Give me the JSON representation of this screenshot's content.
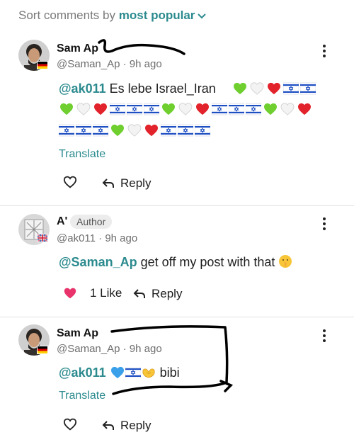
{
  "sort": {
    "label": "Sort comments by",
    "value": "most popular"
  },
  "comments": [
    {
      "author": "Sam Ap",
      "handle": "@Saman_Ap",
      "time": "9h ago",
      "mention": "@ak011",
      "text": "Es lebe Israel_Iran",
      "translate": "Translate",
      "reply": "Reply"
    },
    {
      "author": "A'",
      "author_badge": "Author",
      "handle": "@ak011",
      "time": "9h ago",
      "mention": "@Saman_Ap",
      "text": "get off my post with that",
      "like_count": "1 Like",
      "reply": "Reply"
    },
    {
      "author": "Sam Ap",
      "handle": "@Saman_Ap",
      "time": "9h ago",
      "mention": "@ak011",
      "text": "bibi",
      "translate": "Translate",
      "reply": "Reply"
    }
  ],
  "colors": {
    "accent": "#2b8a8e",
    "like": "#e8336b",
    "scribble": "#000000"
  },
  "icons": [
    "chevron-down-icon",
    "more-options-icon",
    "heart-icon",
    "reply-arrow-icon",
    "green-heart-emoji",
    "white-heart-emoji",
    "red-heart-emoji",
    "israel-flag-emoji",
    "blue-heart-emoji",
    "heart-hands-emoji",
    "shushing-face-emoji",
    "germany-flag",
    "uk-flag"
  ]
}
